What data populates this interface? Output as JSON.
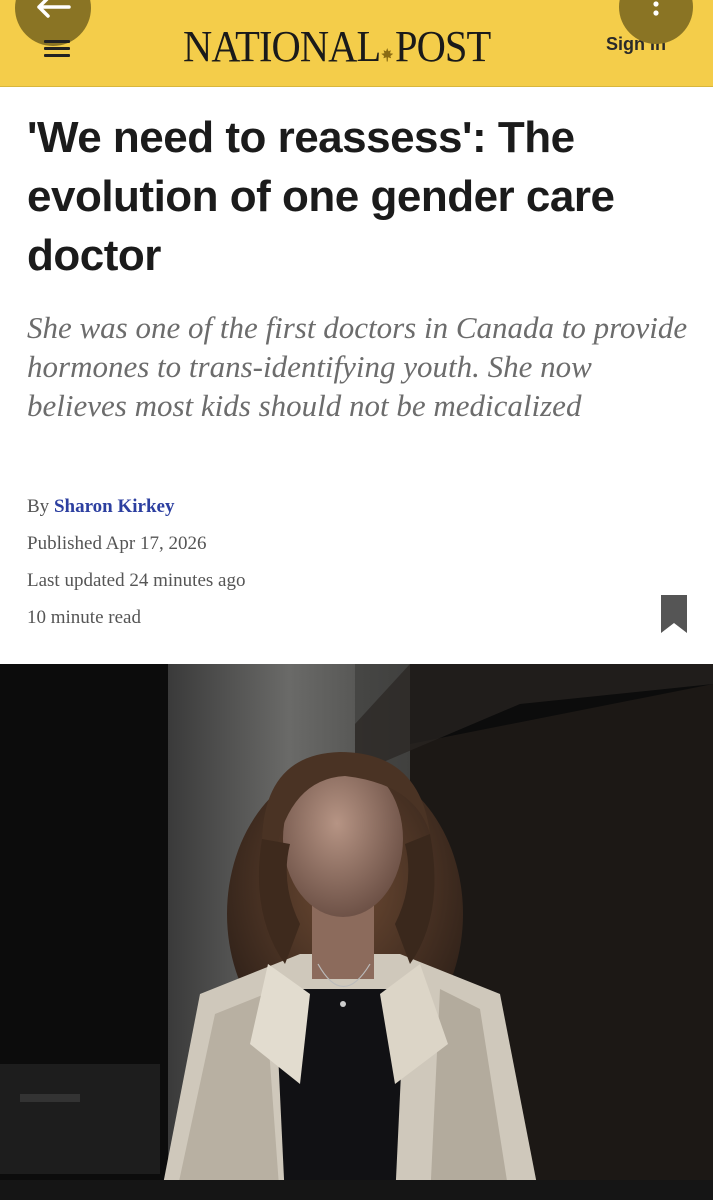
{
  "header": {
    "logo_left": "NATIONAL",
    "logo_right": "POST",
    "sign_in_label": "Sign In"
  },
  "article": {
    "headline": "'We need to reassess': The evolution of one gender care doctor",
    "deck": "She was one of the first doctors in Canada to provide hormones to trans-identifying youth. She now believes most kids should not be medicalized",
    "byline_prefix": "By",
    "author": "Sharon Kirkey",
    "published": "Published Apr 17, 2026",
    "last_updated": "Last updated 24 minutes ago",
    "read_time": "10 minute read"
  },
  "icons": {
    "back": "arrow-left-icon",
    "menu": "hamburger-menu-icon",
    "more": "vertical-dots-icon",
    "bookmark": "bookmark-icon",
    "logo_leaf": "maple-leaf-icon"
  },
  "colors": {
    "header_bg": "#f4cd4a",
    "author_link": "#2c3fa0",
    "bookmark": "#555555"
  }
}
